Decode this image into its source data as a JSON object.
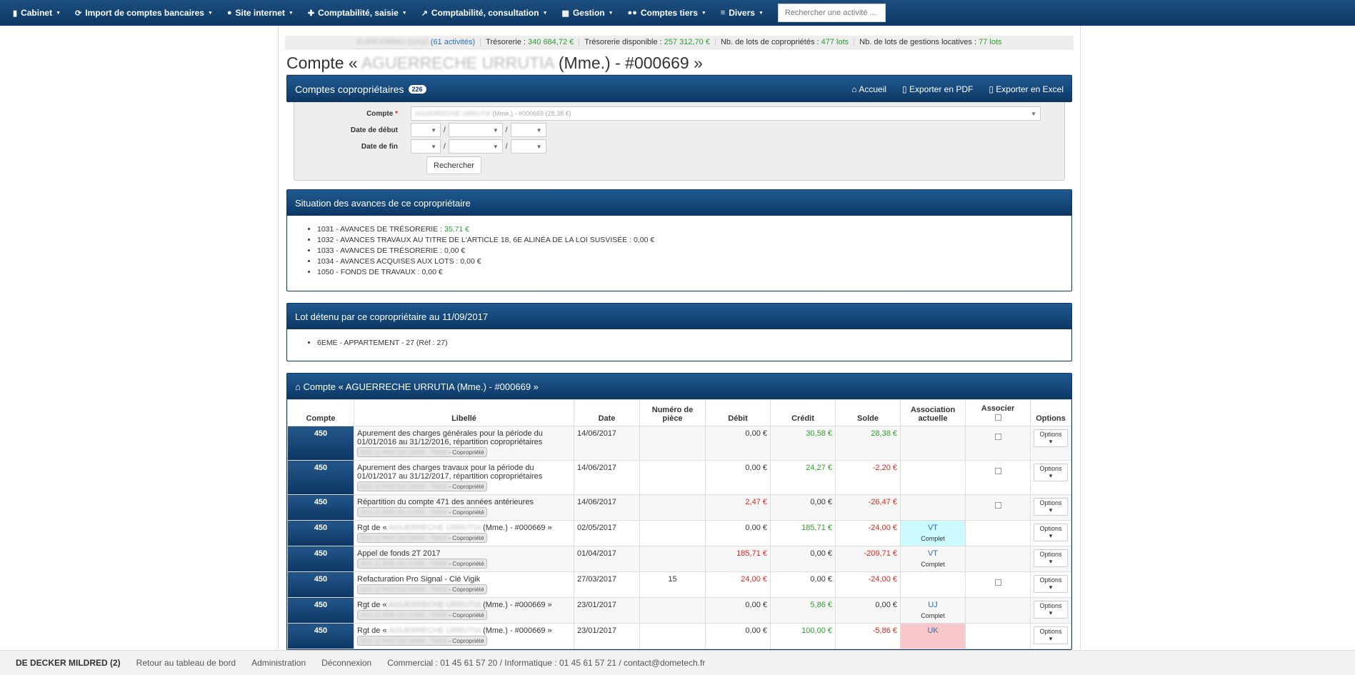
{
  "nav": {
    "items": [
      {
        "icon": "file-icon",
        "glyph": "▮",
        "label": "Cabinet"
      },
      {
        "icon": "refresh-icon",
        "glyph": "⟳",
        "label": "Import de comptes bancaires"
      },
      {
        "icon": "globe-icon",
        "glyph": "●",
        "label": "Site internet"
      },
      {
        "icon": "plus-icon",
        "glyph": "✚",
        "label": "Comptabilité, saisie"
      },
      {
        "icon": "chart-icon",
        "glyph": "↗",
        "label": "Comptabilité, consultation"
      },
      {
        "icon": "calendar-icon",
        "glyph": "▦",
        "label": "Gestion"
      },
      {
        "icon": "users-icon",
        "glyph": "●●",
        "label": "Comptes tiers"
      },
      {
        "icon": "list-icon",
        "glyph": "≡",
        "label": "Divers"
      }
    ],
    "search_placeholder": "Rechercher une activité ..."
  },
  "infobar": {
    "company": "EUREXIMMO (SAS)",
    "activities": "(61 activités)",
    "tresorerie_label": "Trésorerie :",
    "tresorerie_value": "340 684,72 €",
    "dispo_label": "Trésorerie disponible :",
    "dispo_value": "257 312,70 €",
    "lots_copro_label": "Nb. de lots de copropriétés :",
    "lots_copro_value": "477 lots",
    "lots_gestion_label": "Nb. de lots de gestions locatives :",
    "lots_gestion_value": "77 lots"
  },
  "page": {
    "title_prefix": "Compte «",
    "title_name": "AGUERRECHE URRUTIA",
    "title_suffix": "(Mme.) - #000669 »"
  },
  "main_panel": {
    "title": "Comptes copropriétaires",
    "count": "226",
    "actions": {
      "home": "Accueil",
      "pdf": "Exporter en PDF",
      "excel": "Exporter en Excel"
    }
  },
  "filter": {
    "compte_label": "Compte",
    "required_mark": "*",
    "compte_value_blur": "AGUERRECHE URRUTIA",
    "compte_value": "(Mme.) - #000669 (28,38 €)",
    "date_debut_label": "Date de début",
    "date_fin_label": "Date de fin",
    "date_sep": "/",
    "search_button": "Rechercher"
  },
  "avances": {
    "title": "Situation des avances de ce copropriétaire",
    "items": [
      {
        "label": "1031 - AVANCES DE TRÉSORERIE :",
        "value": "35,71 €",
        "color": "green"
      },
      {
        "label": "1032 - AVANCES TRAVAUX AU TITRE DE L'ARTICLE 18, 6E ALINÉA DE LA LOI SUSVISÉE :",
        "value": "0,00 €",
        "color": "none"
      },
      {
        "label": "1033 - AVANCES DE TRÉSORERIE :",
        "value": "0,00 €",
        "color": "none"
      },
      {
        "label": "1034 - AVANCES ACQUISES AUX LOTS :",
        "value": "0,00 €",
        "color": "none"
      },
      {
        "label": "1050 - FONDS DE TRAVAUX :",
        "value": "0,00 €",
        "color": "none"
      }
    ]
  },
  "lot": {
    "title": "Lot détenu par ce copropriétaire au 11/09/2017",
    "items": [
      "6EME - APPARTEMENT - 27 (Réf : 27)"
    ]
  },
  "ledger": {
    "title": "Compte « AGUERRECHE URRUTIA (Mme.) - #000669 »",
    "headers": {
      "compte": "Compte",
      "libelle": "Libellé",
      "date": "Date",
      "piece": "Numéro de pièce",
      "debit": "Débit",
      "credit": "Crédit",
      "solde": "Solde",
      "assoc": "Association actuelle",
      "associer": "Associer",
      "options": "Options"
    },
    "chip_blur": "SDC 11 RUE DU CHER - 75020",
    "chip_suffix": "- Copropriété",
    "options_label": "Options",
    "rows": [
      {
        "compte": "450",
        "libelle": "Apurement des charges générales pour la période du 01/01/2016 au 31/12/2016, répartition copropriétaires",
        "date": "14/06/2017",
        "piece": "",
        "debit": "0,00 €",
        "debit_color": "none",
        "credit": "30,58 €",
        "credit_color": "green",
        "solde": "28,38 €",
        "solde_color": "green",
        "assoc": "",
        "assoc_status": "",
        "assoc_type": "",
        "checkbox": true
      },
      {
        "compte": "450",
        "libelle": "Apurement des charges travaux pour la période du 01/01/2017 au 31/12/2017, répartition copropriétaires",
        "date": "14/06/2017",
        "piece": "",
        "debit": "0,00 €",
        "debit_color": "none",
        "credit": "24,27 €",
        "credit_color": "green",
        "solde": "-2,20 €",
        "solde_color": "red",
        "assoc": "",
        "assoc_status": "",
        "assoc_type": "",
        "checkbox": true
      },
      {
        "compte": "450",
        "libelle": "Répartition du compte 471 des années antérieures",
        "date": "14/06/2017",
        "piece": "",
        "debit": "2,47 €",
        "debit_color": "red",
        "credit": "0,00 €",
        "credit_color": "none",
        "solde": "-26,47 €",
        "solde_color": "red",
        "assoc": "",
        "assoc_status": "",
        "assoc_type": "",
        "checkbox": true
      },
      {
        "compte": "450",
        "libelle_prefix": "Rgt de «",
        "libelle_blur": "AGUERRECHE URRUTIA",
        "libelle_suffix": "(Mme.) - #000669 »",
        "date": "02/05/2017",
        "piece": "",
        "debit": "0,00 €",
        "debit_color": "none",
        "credit": "185,71 €",
        "credit_color": "green",
        "solde": "-24,00 €",
        "solde_color": "red",
        "assoc": "VT",
        "assoc_status": "Complet",
        "assoc_type": "vt",
        "checkbox": false
      },
      {
        "compte": "450",
        "libelle": "Appel de fonds 2T 2017",
        "date": "01/04/2017",
        "piece": "",
        "debit": "185,71 €",
        "debit_color": "red",
        "credit": "0,00 €",
        "credit_color": "none",
        "solde": "-209,71 €",
        "solde_color": "red",
        "assoc": "VT",
        "assoc_status": "Complet",
        "assoc_type": "vt",
        "checkbox": false
      },
      {
        "compte": "450",
        "libelle": "Refacturation Pro Signal - Clé Vigik",
        "date": "27/03/2017",
        "piece": "15",
        "debit": "24,00 €",
        "debit_color": "red",
        "credit": "0,00 €",
        "credit_color": "none",
        "solde": "-24,00 €",
        "solde_color": "red",
        "assoc": "",
        "assoc_status": "",
        "assoc_type": "",
        "checkbox": true
      },
      {
        "compte": "450",
        "libelle_prefix": "Rgt de «",
        "libelle_blur": "AGUERRECHE URRUTIA",
        "libelle_suffix": "(Mme.) - #000669 »",
        "date": "23/01/2017",
        "piece": "",
        "debit": "0,00 €",
        "debit_color": "none",
        "credit": "5,86 €",
        "credit_color": "green",
        "solde": "0,00 €",
        "solde_color": "none",
        "assoc": "UJ",
        "assoc_status": "Complet",
        "assoc_type": "uj",
        "checkbox": false
      },
      {
        "compte": "450",
        "libelle_prefix": "Rgt de «",
        "libelle_blur": "AGUERRECHE URRUTIA",
        "libelle_suffix": "(Mme.) - #000669 »",
        "date": "23/01/2017",
        "piece": "",
        "debit": "0,00 €",
        "debit_color": "none",
        "credit": "100,00 €",
        "credit_color": "green",
        "solde": "-5,86 €",
        "solde_color": "red",
        "assoc": "UK",
        "assoc_status": "",
        "assoc_type": "uk",
        "checkbox": false
      }
    ]
  },
  "footer": {
    "user": "DE DECKER MILDRED (2)",
    "links": [
      "Retour au tableau de bord",
      "Administration",
      "Déconnexion"
    ],
    "contact": "Commercial : 01 45 61 57 20 / Informatique : 01 45 61 57 21 / contact@dometech.fr"
  }
}
